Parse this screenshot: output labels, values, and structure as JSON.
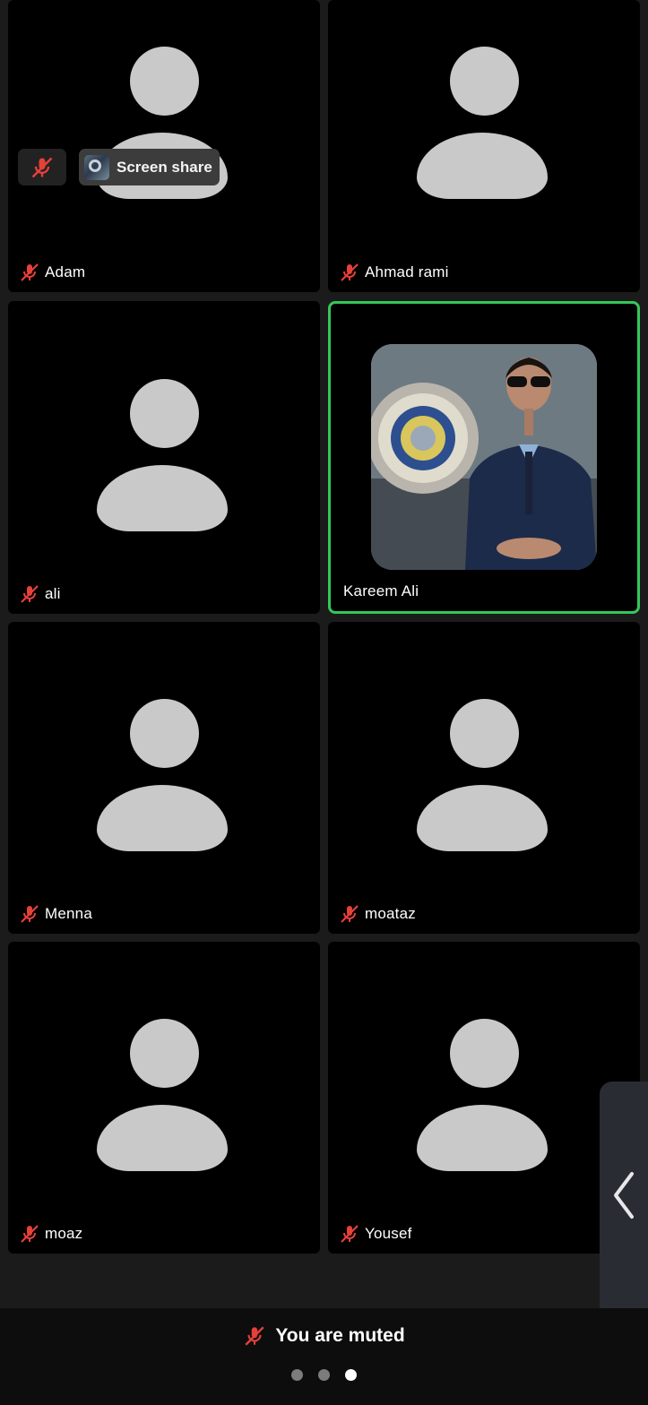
{
  "tiles": [
    {
      "name": "Adam",
      "muted": true
    },
    {
      "name": "Ahmad rami",
      "muted": true
    },
    {
      "name": "ali",
      "muted": true
    },
    {
      "name": "Kareem Ali",
      "muted": false,
      "speaking": true
    },
    {
      "name": "Menna",
      "muted": true
    },
    {
      "name": "moataz",
      "muted": true
    },
    {
      "name": "moaz",
      "muted": true
    },
    {
      "name": "Yousef",
      "muted": true
    }
  ],
  "overlay": {
    "screen_share_label": "Screen share"
  },
  "status": {
    "muted_text": "You are muted"
  },
  "pagination": {
    "pages": 3,
    "current": 3
  },
  "colors": {
    "speaking_border": "#35c759",
    "mute_icon": "#e5403a",
    "tile_bg": "#000000",
    "avatar": "#c9c9c9"
  },
  "icons": {
    "mute": "mic-off-icon",
    "side_tab": "chevron-left-icon"
  }
}
